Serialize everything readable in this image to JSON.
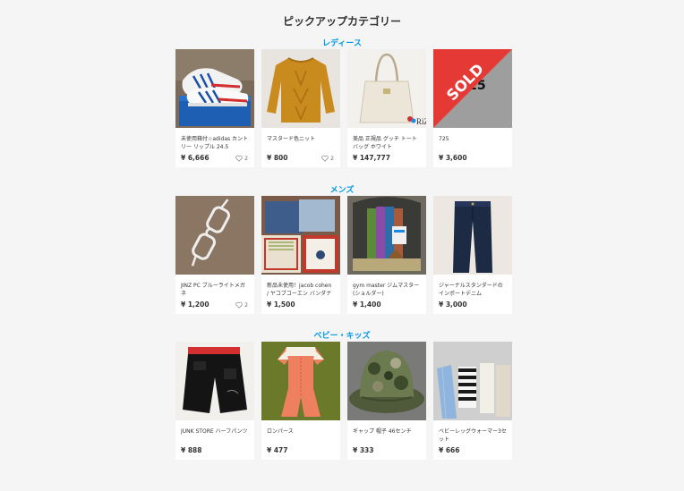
{
  "page_title": "ピックアップカテゴリー",
  "colors": {
    "accent": "#0099e8",
    "sold": "#e53935",
    "background": "#f5f5f5"
  },
  "sections": [
    {
      "title": "レディース",
      "items": [
        {
          "name": "未使用箱付☆adidas カントリー リップル 24.5",
          "price": "¥ 6,666",
          "likes": "2",
          "image": "sneakers"
        },
        {
          "name": "マスタード色ニット",
          "price": "¥ 800",
          "likes": "2",
          "image": "mustard-knit"
        },
        {
          "name": "美品 正規品 グッチ トートバッグ ホワイト",
          "price": "¥ 147,777",
          "image": "white-tote",
          "watermark": "RiZ"
        },
        {
          "name": "725",
          "price": "¥ 3,600",
          "image": "placeholder",
          "placeholder_text": "725",
          "badge": "SOLD"
        }
      ]
    },
    {
      "title": "メンズ",
      "items": [
        {
          "name": "JINZ PC ブルーライトメガネ",
          "price": "¥ 1,200",
          "likes": "2",
          "image": "glasses"
        },
        {
          "name": "新品未使用！jacob cohen / ヤコブコーエン バンダナ",
          "price": "¥ 1,500",
          "image": "handkerchiefs"
        },
        {
          "name": "gym master ジムマスター (ショルダー)",
          "price": "¥ 1,400",
          "image": "shoulder-bag"
        },
        {
          "name": "ジャーナルスタンダードのインポートデニム",
          "price": "¥ 3,000",
          "image": "denim"
        }
      ]
    },
    {
      "title": "ベビー・キッズ",
      "items": [
        {
          "name": "JUNK STORE ハーフパンツ",
          "price": "¥ 888",
          "image": "half-pants"
        },
        {
          "name": "ロンパース",
          "price": "¥ 477",
          "image": "romper"
        },
        {
          "name": "ギャップ 帽子 46センチ",
          "price": "¥ 333",
          "image": "camo-hat"
        },
        {
          "name": "ベビーレッグウォーマー3セット",
          "price": "¥ 666",
          "image": "leg-warmers"
        }
      ]
    }
  ]
}
